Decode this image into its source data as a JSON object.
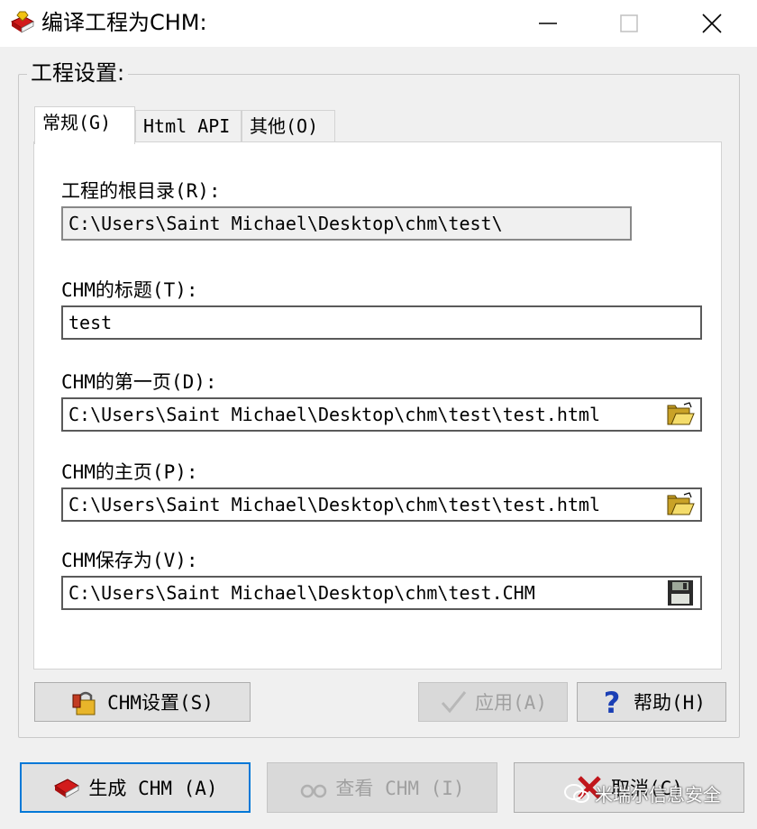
{
  "window": {
    "title": "编译工程为CHM:",
    "icon": "book-gem-icon"
  },
  "group": {
    "label": "工程设置:"
  },
  "tabs": [
    {
      "label": "常规(G)",
      "active": true
    },
    {
      "label": "Html API",
      "active": false
    },
    {
      "label": "其他(O)",
      "active": false
    }
  ],
  "fields": {
    "root_dir": {
      "label": "工程的根目录(R):",
      "value": "C:\\Users\\Saint Michael\\Desktop\\chm\\test\\"
    },
    "chm_title": {
      "label": "CHM的标题(T):",
      "value": "test"
    },
    "first_page": {
      "label": "CHM的第一页(D):",
      "value": "C:\\Users\\Saint Michael\\Desktop\\chm\\test\\test.html",
      "icon": "open-folder-icon"
    },
    "home_page": {
      "label": "CHM的主页(P):",
      "value": "C:\\Users\\Saint Michael\\Desktop\\chm\\test\\test.html",
      "icon": "open-folder-icon"
    },
    "save_as": {
      "label": "CHM保存为(V):",
      "value": "C:\\Users\\Saint Michael\\Desktop\\chm\\test.CHM",
      "icon": "floppy-disk-icon"
    }
  },
  "buttons": {
    "chm_settings": "CHM设置(S)",
    "apply": "应用(A)",
    "help": "帮助(H)",
    "build": "生成 CHM (A)",
    "view": "查看 CHM (I)",
    "cancel": "取消(C)"
  },
  "watermark": "米瑞尔信息安全",
  "colors": {
    "default_border": "#0078d7",
    "face": "#f0f0f0",
    "button": "#e1e1e1"
  }
}
